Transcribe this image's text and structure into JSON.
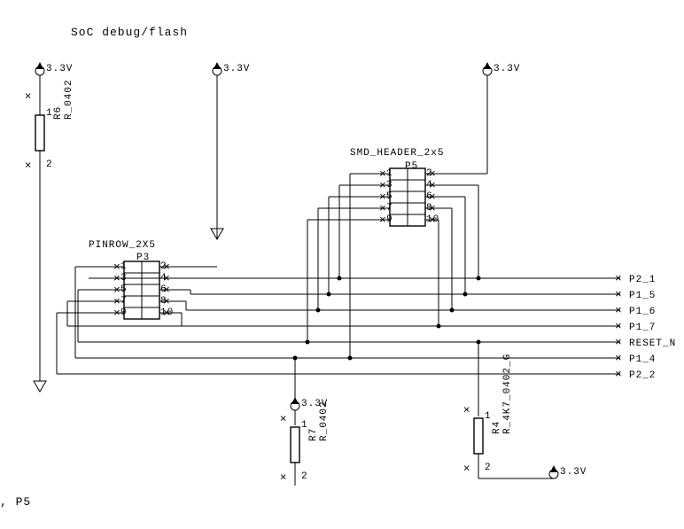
{
  "title": "SoC debug/flash",
  "pwr_tl": "3.3V",
  "pwr_tc": "3.3V",
  "pwr_tr": "3.3V",
  "pwr_bc": "3.3V",
  "pwr_br": "3.3V",
  "r6_ref": "R6",
  "r6_val": "R_0402",
  "r6_pin1": "1",
  "r6_pin2": "2",
  "r7_ref": "R7",
  "r7_val": "R_0402",
  "r7_pin1": "1",
  "r7_pin2": "2",
  "r4_ref": "R4",
  "r4_val": "R_4K7_0402_G",
  "r4_pin1": "1",
  "r4_pin2": "2",
  "p3_ref": "P3",
  "p3_type": "PINROW_2X5",
  "p3_p1": "1",
  "p3_p2": "2",
  "p3_p3": "3",
  "p3_p4": "4",
  "p3_p5": "5",
  "p3_p6": "6",
  "p3_p7": "7",
  "p3_p8": "8",
  "p3_p9": "9",
  "p3_p10": "10",
  "p5_ref": "P5",
  "p5_type": "SMD_HEADER_2x5",
  "p5_p1": "1",
  "p5_p2": "2",
  "p5_p3": "3",
  "p5_p4": "4",
  "p5_p5": "5",
  "p5_p6": "6",
  "p5_p7": "7",
  "p5_p8": "8",
  "p5_p9": "9",
  "p5_p10": "10",
  "net1": "P2_1",
  "net2": "P1_5",
  "net3": "P1_6",
  "net4": "P1_7",
  "net5": "RESET_N",
  "net6": "P1_4",
  "net7": "P2_2",
  "bottom_left": ", P5"
}
